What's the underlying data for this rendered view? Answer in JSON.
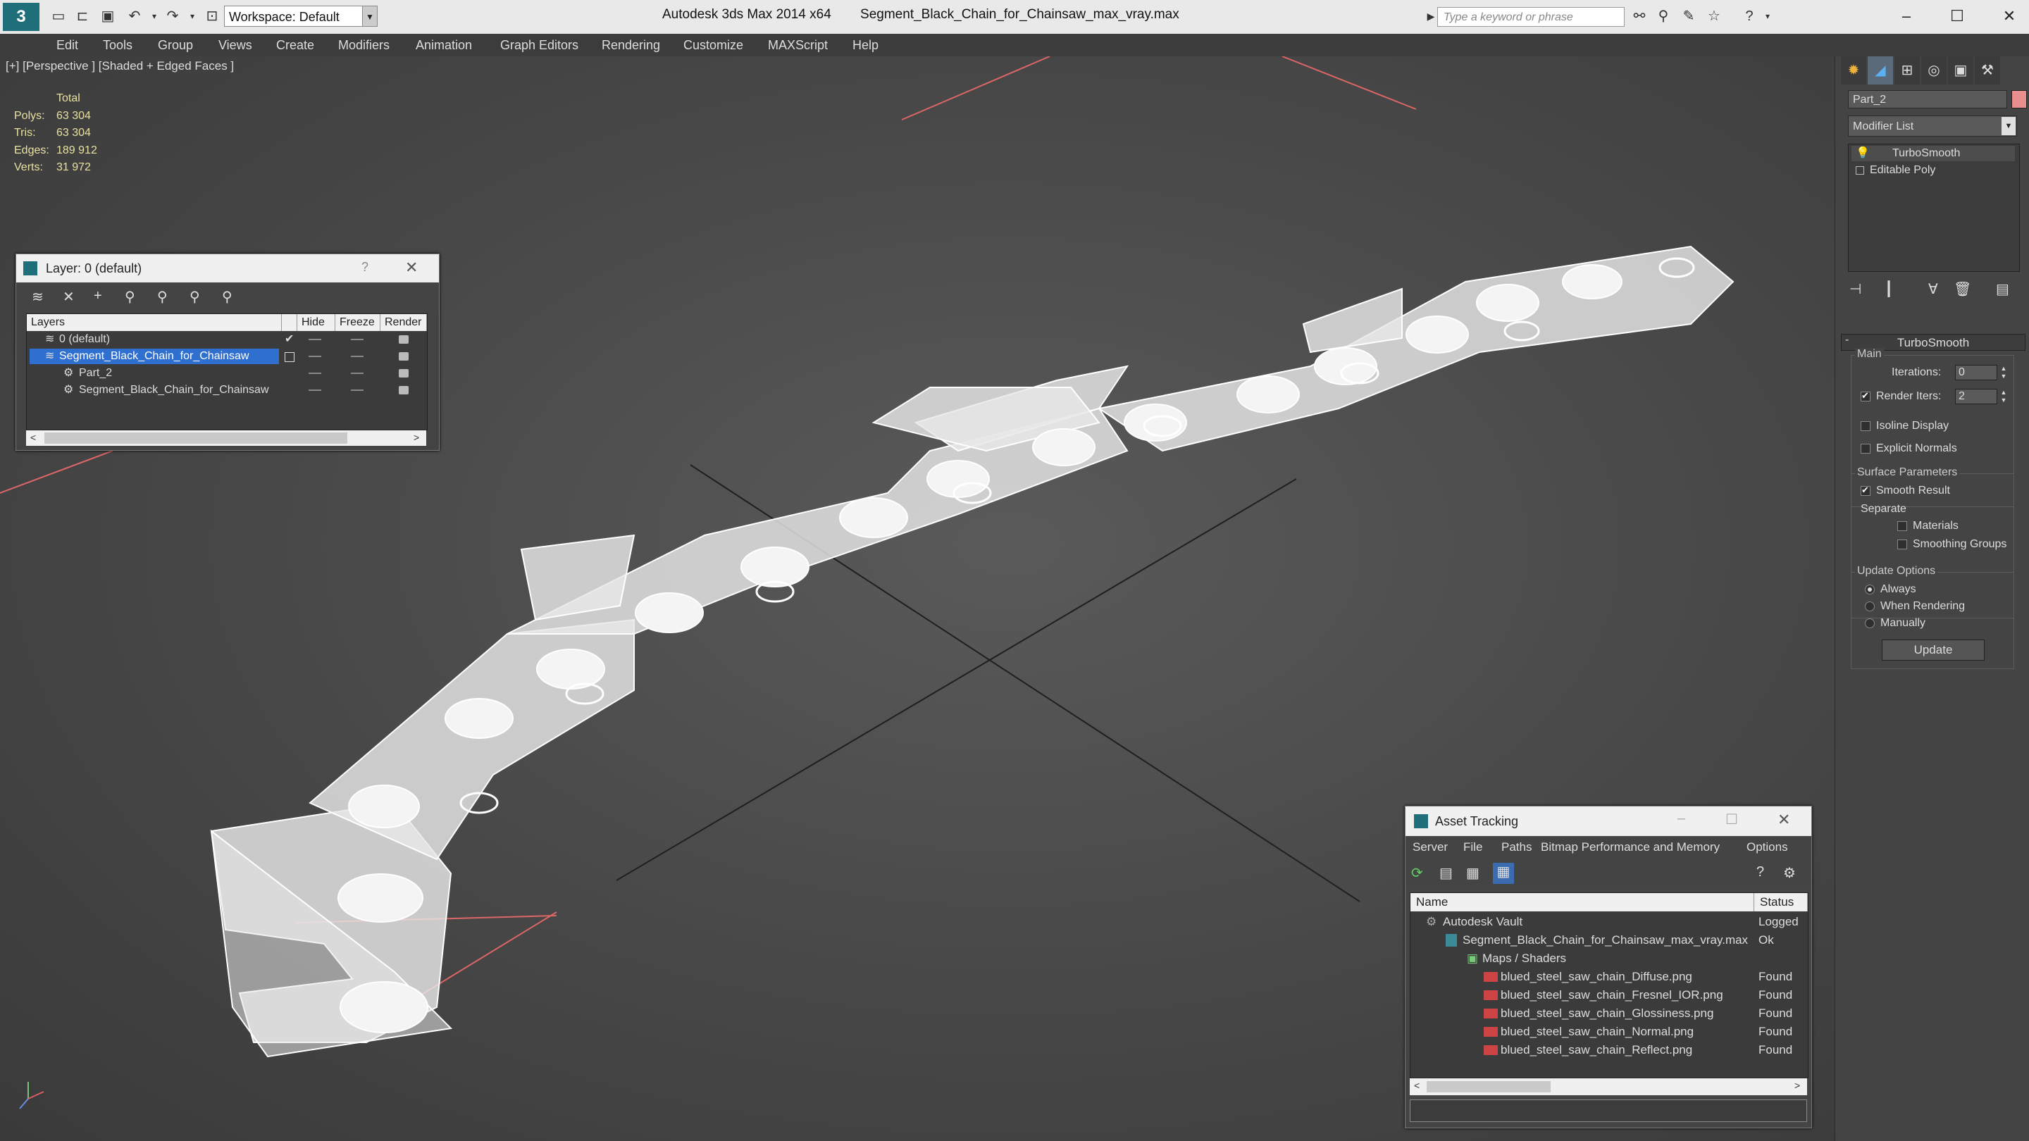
{
  "app": {
    "title": "Autodesk 3ds Max  2014 x64",
    "filename": "Segment_Black_Chain_for_Chainsaw_max_vray.max",
    "workspace": "Workspace: Default",
    "search_placeholder": "Type a keyword or phrase"
  },
  "menu": [
    "Edit",
    "Tools",
    "Group",
    "Views",
    "Create",
    "Modifiers",
    "Animation",
    "Graph Editors",
    "Rendering",
    "Customize",
    "MAXScript",
    "Help"
  ],
  "viewport": {
    "label": "[+] [Perspective ] [Shaded + Edged Faces ]",
    "stats": {
      "header": "Total",
      "rows": [
        {
          "label": "Polys:",
          "value": "63 304"
        },
        {
          "label": "Tris:",
          "value": "63 304"
        },
        {
          "label": "Edges:",
          "value": "189 912"
        },
        {
          "label": "Verts:",
          "value": "31 972"
        }
      ]
    }
  },
  "layer_panel": {
    "title": "Layer: 0 (default)",
    "help": "?",
    "columns": [
      "Layers",
      "Hide",
      "Freeze",
      "Render"
    ],
    "rows": [
      {
        "name": "0 (default)"
      },
      {
        "name": "Segment_Black_Chain_for_Chainsaw"
      },
      {
        "name": "Part_2"
      },
      {
        "name": "Segment_Black_Chain_for_Chainsaw"
      }
    ]
  },
  "command_panel": {
    "object_name": "Part_2",
    "object_color": "#e98e8e",
    "modifier_list": "Modifier List",
    "stack": [
      "TurboSmooth",
      "Editable Poly"
    ],
    "rollout_title": "TurboSmooth",
    "main_label": "Main",
    "iterations_label": "Iterations:",
    "iterations_value": "0",
    "render_iters_label": "Render Iters:",
    "render_iters_value": "2",
    "isoline_label": "Isoline Display",
    "explicit_label": "Explicit Normals",
    "surface_label": "Surface Parameters",
    "smooth_label": "Smooth Result",
    "separate_label": "Separate",
    "materials_label": "Materials",
    "smoothing_groups_label": "Smoothing Groups",
    "update_options_label": "Update Options",
    "always_label": "Always",
    "when_rendering_label": "When Rendering",
    "manually_label": "Manually",
    "update_button": "Update"
  },
  "asset_tracking": {
    "title": "Asset Tracking",
    "menu": [
      "Server",
      "File",
      "Paths",
      "Bitmap Performance and Memory",
      "Options"
    ],
    "columns": [
      "Name",
      "Status"
    ],
    "rows": [
      {
        "name": "Autodesk Vault",
        "status": "Logged"
      },
      {
        "name": "Segment_Black_Chain_for_Chainsaw_max_vray.max",
        "status": "Ok"
      },
      {
        "name": "Maps / Shaders",
        "status": ""
      },
      {
        "name": "blued_steel_saw_chain_Diffuse.png",
        "status": "Found"
      },
      {
        "name": "blued_steel_saw_chain_Fresnel_IOR.png",
        "status": "Found"
      },
      {
        "name": "blued_steel_saw_chain_Glossiness.png",
        "status": "Found"
      },
      {
        "name": "blued_steel_saw_chain_Normal.png",
        "status": "Found"
      },
      {
        "name": "blued_steel_saw_chain_Reflect.png",
        "status": "Found"
      }
    ]
  }
}
